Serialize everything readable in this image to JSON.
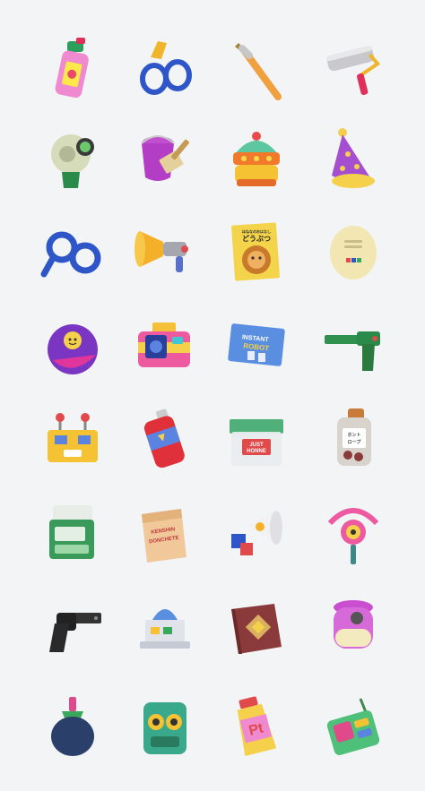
{
  "gallery": {
    "items": [
      {
        "name": "Spray bottle"
      },
      {
        "name": "Goggles"
      },
      {
        "name": "Paintbrush"
      },
      {
        "name": "Paint roller"
      },
      {
        "name": "Camera helmet"
      },
      {
        "name": "Paint bucket and brush"
      },
      {
        "name": "Dome robot"
      },
      {
        "name": "Party hat"
      },
      {
        "name": "Magnifying glasses"
      },
      {
        "name": "Megaphone gun"
      },
      {
        "name": "Picture book",
        "text": "どうぶつ",
        "subtext": "ほねなのおはなし"
      },
      {
        "name": "Egg device"
      },
      {
        "name": "Ball with face"
      },
      {
        "name": "Pink camera"
      },
      {
        "name": "Instant robot box",
        "text": "INSTANT",
        "subtext": "ROBOT"
      },
      {
        "name": "Green pistol"
      },
      {
        "name": "Robot head"
      },
      {
        "name": "Spray can"
      },
      {
        "name": "Container",
        "text": "JUST",
        "subtext": "HONNE"
      },
      {
        "name": "Jar",
        "text": "ホント",
        "subtext": "ロープ"
      },
      {
        "name": "Green computer"
      },
      {
        "name": "Desk calendar",
        "text": "KENSHIN",
        "subtext": "DONCHETE"
      },
      {
        "name": "Megaphone with dice"
      },
      {
        "name": "Gauge wand"
      },
      {
        "name": "Black revolver"
      },
      {
        "name": "Observatory"
      },
      {
        "name": "Book"
      },
      {
        "name": "Lantern"
      },
      {
        "name": "Feather duster"
      },
      {
        "name": "Walkie talkie"
      },
      {
        "name": "Paint tube",
        "text": "Pt"
      },
      {
        "name": "Radio"
      }
    ]
  }
}
